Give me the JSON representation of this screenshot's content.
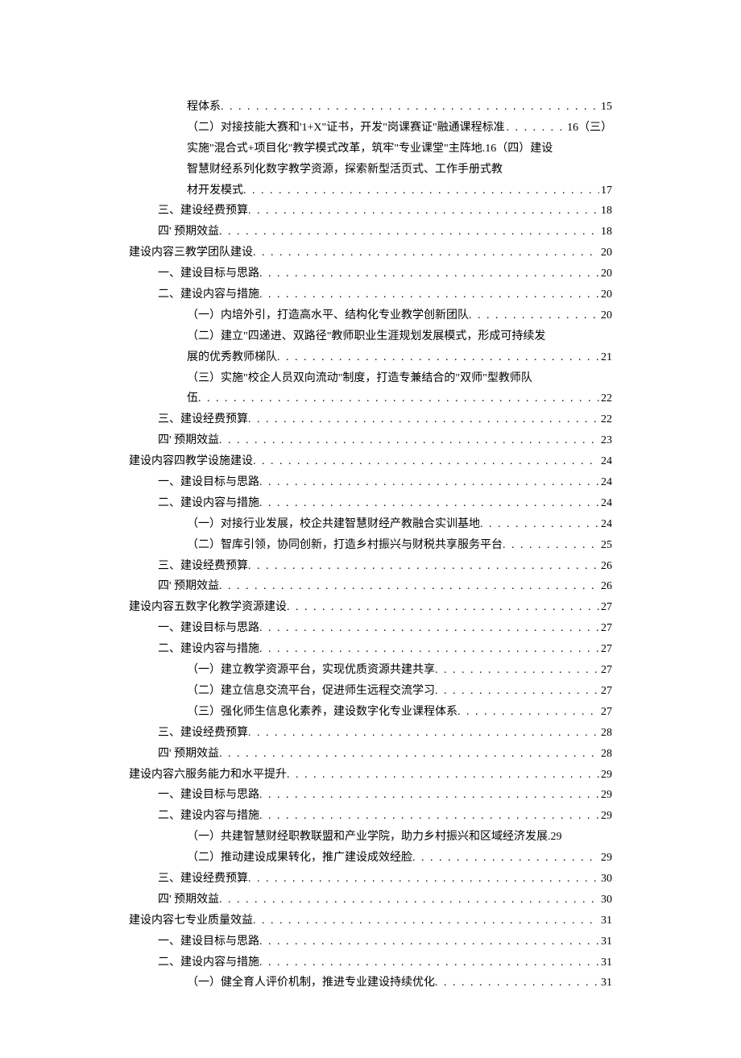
{
  "toc": [
    {
      "indent": 2,
      "text": "程体系",
      "page": "15",
      "dots": true
    },
    {
      "indent": 2,
      "text": "（二）对接技能大赛和'1+X\"证书，开发\"岗课赛证\"融通课程标准",
      "page": "16（三）",
      "dots_short": true
    },
    {
      "indent": 2,
      "text": "实施\"混合式+项目化\"教学模式改革，筑牢\"专业课堂\"主阵地.16（四）建设",
      "page": "",
      "plain": true
    },
    {
      "indent": 2,
      "text": "智慧财经系列化数字教学资源，探索新型活页式、工作手册式教",
      "page": "",
      "plain": true
    },
    {
      "indent": 2,
      "text": "材开发模式",
      "page": "17",
      "dots": true
    },
    {
      "indent": 1,
      "text": "三、建设经费预算",
      "page": "18",
      "dots": true
    },
    {
      "indent": 1,
      "text": "四' 预期效益",
      "page": "18",
      "dots": true
    },
    {
      "indent": 0,
      "text": "建设内容三教学团队建设",
      "page": "20",
      "dots": true
    },
    {
      "indent": 1,
      "text": "一、建设目标与思路",
      "page": "20",
      "dots": true
    },
    {
      "indent": 1,
      "text": "二、建设内容与措施",
      "page": "20",
      "dots": true
    },
    {
      "indent": 2,
      "text": "（一）内培外引，打造高水平、结构化专业教学创新团队",
      "page": "20",
      "dots": true
    },
    {
      "indent": 2,
      "text": "（二）建立\"四递进、双路径\"教师职业生涯规划发展模式，形成可持续发",
      "page": "",
      "plain": true
    },
    {
      "indent": 2,
      "text": "展的优秀教师梯队",
      "page": "21",
      "dots": true
    },
    {
      "indent": 2,
      "text": "（三）实施\"校企人员双向流动\"制度，打造专兼结合的\"双师\"型教师队",
      "page": "",
      "plain": true
    },
    {
      "indent": 2,
      "text": "伍",
      "page": "22",
      "dots": true
    },
    {
      "indent": 1,
      "text": "三、建设经费预算",
      "page": "22",
      "dots": true
    },
    {
      "indent": 1,
      "text": "四' 预期效益",
      "page": "23",
      "dots": true
    },
    {
      "indent": 0,
      "text": "建设内容四教学设施建设",
      "page": "24",
      "dots": true
    },
    {
      "indent": 1,
      "text": "一、建设目标与思路",
      "page": "24",
      "dots": true
    },
    {
      "indent": 1,
      "text": "二、建设内容与措施",
      "page": "24",
      "dots": true
    },
    {
      "indent": 2,
      "text": "（一）对接行业发展，校企共建智慧财经产教融合实训基地",
      "page": "24",
      "dots": true
    },
    {
      "indent": 2,
      "text": "（二）智库引领，协同创新，打造乡村振兴与财税共享服务平台",
      "page": "25",
      "dots": true
    },
    {
      "indent": 1,
      "text": "三、建设经费预算",
      "page": "26",
      "dots": true
    },
    {
      "indent": 1,
      "text": "四' 预期效益",
      "page": "26",
      "dots": true
    },
    {
      "indent": 0,
      "text": "建设内容五数字化教学资源建设",
      "page": "27",
      "dots": true
    },
    {
      "indent": 1,
      "text": "一、建设目标与思路",
      "page": "27",
      "dots": true
    },
    {
      "indent": 1,
      "text": "二、建设内容与措施",
      "page": "27",
      "dots": true
    },
    {
      "indent": 2,
      "text": "（一）建立教学资源平台，实现优质资源共建共享",
      "page": "27",
      "dots": true
    },
    {
      "indent": 2,
      "text": "（二）建立信息交流平台，促进师生远程交流学习",
      "page": "27",
      "dots": true
    },
    {
      "indent": 2,
      "text": "（三）强化师生信息化素养，建设数字化专业课程体系",
      "page": "27",
      "dots": true
    },
    {
      "indent": 1,
      "text": "三、建设经费预算",
      "page": "28",
      "dots": true
    },
    {
      "indent": 1,
      "text": "四' 预期效益",
      "page": "28",
      "dots": true
    },
    {
      "indent": 0,
      "text": "建设内容六服务能力和水平提升",
      "page": "29",
      "dots": true
    },
    {
      "indent": 1,
      "text": "一、建设目标与思路",
      "page": "29",
      "dots": true
    },
    {
      "indent": 1,
      "text": "二、建设内容与措施",
      "page": "29",
      "dots": true
    },
    {
      "indent": 2,
      "text": "（一）共建智慧财经职教联盟和产业学院，助力乡村振兴和区域经济发展.29",
      "page": "",
      "plain": true
    },
    {
      "indent": 2,
      "text": "（二）推动建设成果转化，推广建设成效经脸",
      "page": "29",
      "dots": true
    },
    {
      "indent": 1,
      "text": "三、建设经费预算",
      "page": "30",
      "dots": true
    },
    {
      "indent": 1,
      "text": "四' 预期效益",
      "page": "30",
      "dots": true
    },
    {
      "indent": 0,
      "text": "建设内容七专业质量效益",
      "page": "31",
      "dots": true
    },
    {
      "indent": 1,
      "text": "一、建设目标与思路",
      "page": "31",
      "dots": true
    },
    {
      "indent": 1,
      "text": "二、建设内容与措施",
      "page": "31",
      "dots": true
    },
    {
      "indent": 2,
      "text": "（一）健全育人评价机制，推进专业建设持续优化",
      "page": "31",
      "dots": true
    }
  ]
}
